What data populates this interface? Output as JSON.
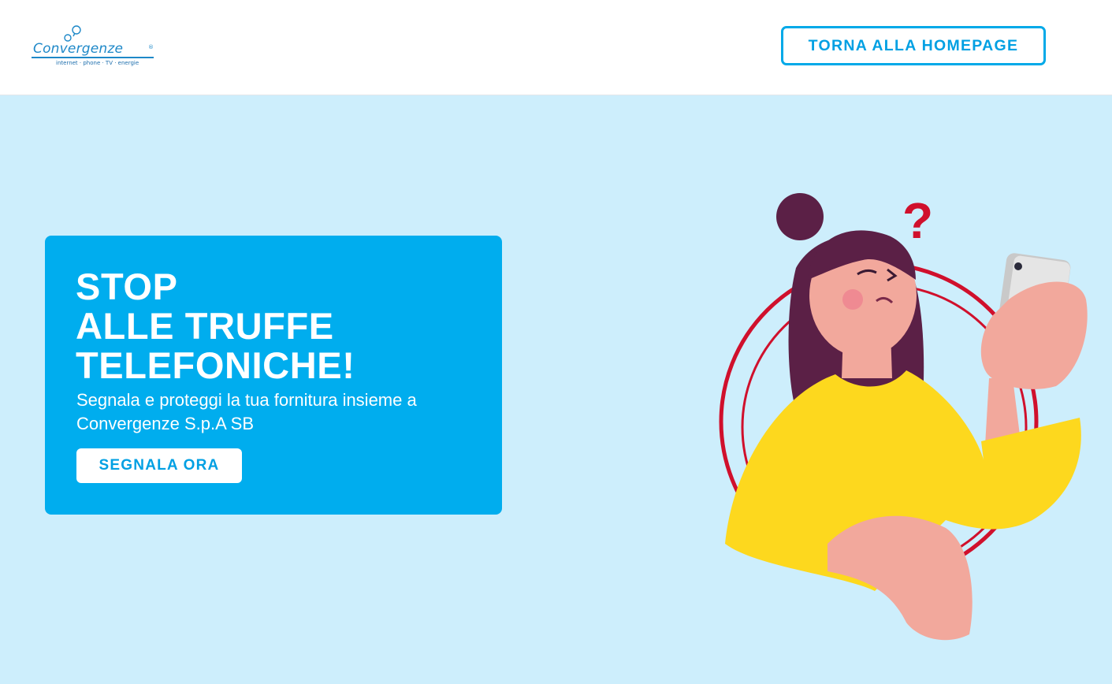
{
  "header": {
    "logo": {
      "brand": "Convergenze",
      "registered": "®",
      "tagline": "internet · phone · TV · energie"
    },
    "home_button_label": "TORNA ALLA HOMEPAGE"
  },
  "hero": {
    "title_lines": [
      "STOP",
      "ALLE TRUFFE",
      "TELEFONICHE!"
    ],
    "subtitle": "Segnala e proteggi la tua fornitura insieme a Convergenze S.p.A SB",
    "cta_label": "SEGNALA ORA"
  },
  "illustration": {
    "question_mark": "?"
  },
  "colors": {
    "page_background": "#cdeefc",
    "card_background": "#00adee",
    "accent": "#00a9e8",
    "ring": "#d0102c",
    "sweater": "#fdd81e",
    "hair": "#5b2046",
    "skin": "#f2a89c"
  }
}
